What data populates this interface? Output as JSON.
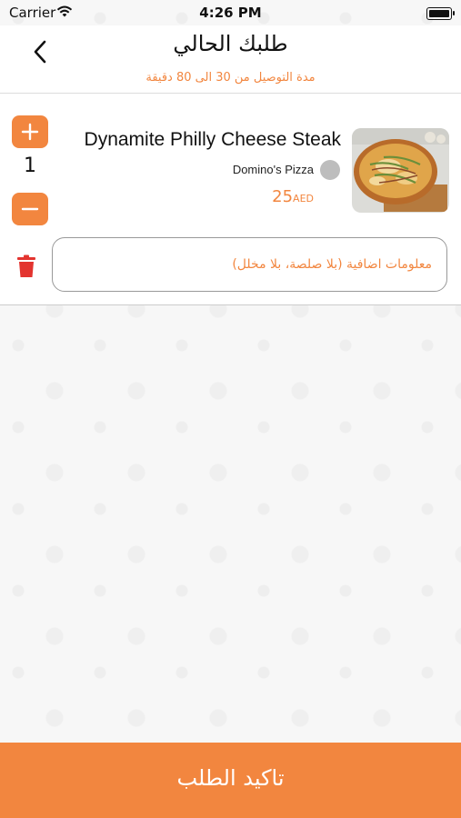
{
  "status_bar": {
    "carrier": "Carrier",
    "time": "4:26 PM"
  },
  "header": {
    "title": "طلبك الحالي",
    "subtitle": "مدة التوصيل من 30 الى 80 دقيقة"
  },
  "cart_item": {
    "quantity": "1",
    "name": "Dynamite Philly Cheese Steak",
    "restaurant": "Domino's Pizza",
    "price": "25",
    "currency": "AED"
  },
  "notes": {
    "value": "معلومات اضافية (بلا صلصة، بلا مخلل)"
  },
  "footer": {
    "confirm_label": "تاكيد الطلب"
  },
  "colors": {
    "accent": "#f2863f",
    "danger": "#e3342f",
    "text": "#111111"
  },
  "icons": [
    "wifi-icon",
    "battery-icon",
    "back-chevron-icon",
    "plus-icon",
    "minus-icon",
    "trash-icon",
    "restaurant-logo-icon"
  ]
}
